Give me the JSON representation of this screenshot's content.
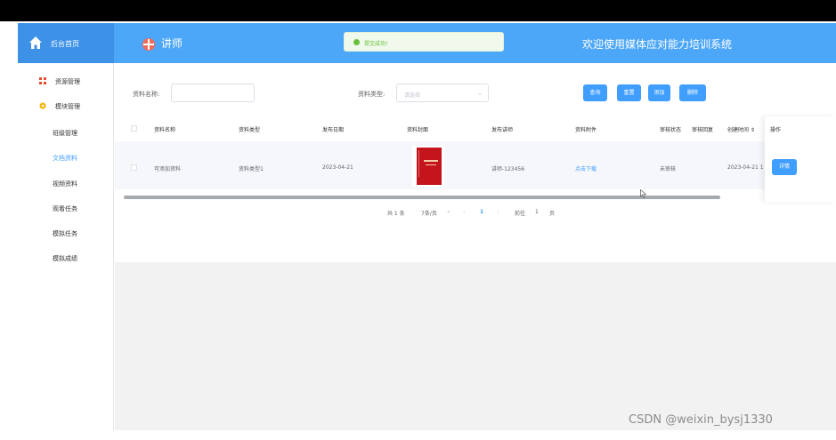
{
  "header": {
    "home_label": "后台首页",
    "role_label": "讲师",
    "toast": "提交成功!",
    "welcome": "欢迎使用媒体应对能力培训系统"
  },
  "sidebar": {
    "groups": [
      {
        "label": "资源管理"
      },
      {
        "label": "模块管理"
      }
    ],
    "items": [
      {
        "label": "班级管理"
      },
      {
        "label": "文档资料"
      },
      {
        "label": "视频资料"
      },
      {
        "label": "观看任务"
      },
      {
        "label": "模拟任务"
      },
      {
        "label": "模拟成绩"
      }
    ]
  },
  "filters": {
    "name_label": "资料名称:",
    "name_value": "",
    "type_label": "资料类型:",
    "type_placeholder": "请选择"
  },
  "actions": {
    "search": "查询",
    "reset": "重置",
    "add": "添加",
    "delete": "删除"
  },
  "table": {
    "headers": [
      "资料名称",
      "资料类型",
      "发布日期",
      "资料封面",
      "发布讲师",
      "资料附件",
      "审核状态",
      "审核回复",
      "创建时间 ⇕",
      "操作"
    ],
    "rows": [
      {
        "name": "可添加资料",
        "type": "资料类型1",
        "date": "2023-04-21",
        "teacher": "讲师-123456",
        "attachment": "点击下载",
        "status": "未审核",
        "reply": "",
        "created": "2023-04-21 1",
        "op": "详情"
      }
    ]
  },
  "pagination": {
    "total": "共 1 条",
    "page_size": "7条/页",
    "first": "«",
    "prev": "‹",
    "current": "1",
    "next": "›",
    "goto_label": "前往",
    "goto_value": "1",
    "page_suffix": "页"
  },
  "watermark": "CSDN @weixin_bysj1330",
  "colors": {
    "primary": "#409eff",
    "header": "#4da7f9",
    "success": "#67c23a"
  }
}
